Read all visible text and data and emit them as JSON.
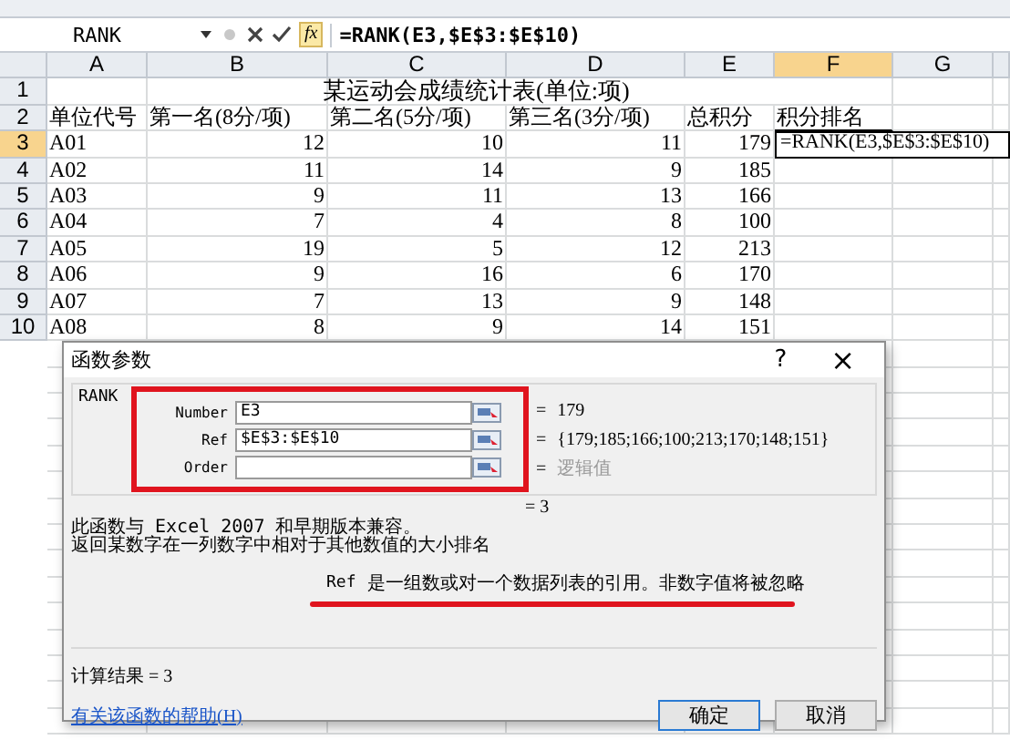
{
  "formula_bar": {
    "name_box": "RANK",
    "function_button": "fx",
    "formula": "=RANK(E3,$E$3:$E$10)"
  },
  "sheet": {
    "columns": [
      {
        "label": "A",
        "selected": false
      },
      {
        "label": "B",
        "selected": false
      },
      {
        "label": "C",
        "selected": false
      },
      {
        "label": "D",
        "selected": false
      },
      {
        "label": "E",
        "selected": false
      },
      {
        "label": "F",
        "selected": true
      },
      {
        "label": "G",
        "selected": false
      }
    ],
    "rows": [
      {
        "number": "1",
        "selected": false,
        "kind": "title",
        "cells": [
          "",
          "",
          "某运动会成绩统计表(单位:项)"
        ]
      },
      {
        "number": "2",
        "selected": false,
        "kind": "header",
        "cells": [
          "单位代号",
          "第一名(8分/项)",
          "第二名(5分/项)",
          "第三名(3分/项)",
          "总积分",
          "积分排名"
        ]
      },
      {
        "number": "3",
        "selected": true,
        "kind": "data",
        "cells": [
          "A01",
          "12",
          "10",
          "11",
          "179",
          "=RANK(E3,$E$3:$E$10)"
        ]
      },
      {
        "number": "4",
        "selected": false,
        "kind": "data",
        "cells": [
          "A02",
          "11",
          "14",
          "9",
          "185"
        ]
      },
      {
        "number": "5",
        "selected": false,
        "kind": "data",
        "cells": [
          "A03",
          "9",
          "11",
          "13",
          "166"
        ]
      },
      {
        "number": "6",
        "selected": false,
        "kind": "data",
        "cells": [
          "A04",
          "7",
          "4",
          "8",
          "100"
        ]
      },
      {
        "number": "7",
        "selected": false,
        "kind": "data",
        "cells": [
          "A05",
          "19",
          "5",
          "12",
          "213"
        ]
      },
      {
        "number": "8",
        "selected": false,
        "kind": "data",
        "cells": [
          "A06",
          "9",
          "16",
          "6",
          "170"
        ]
      },
      {
        "number": "9",
        "selected": false,
        "kind": "data",
        "cells": [
          "A07",
          "7",
          "13",
          "9",
          "148"
        ]
      },
      {
        "number": "10",
        "selected": false,
        "kind": "data",
        "cells": [
          "A08",
          "8",
          "9",
          "14",
          "151"
        ]
      }
    ]
  },
  "dialog": {
    "title": "函数参数",
    "help_glyph": "?",
    "close_glyph": "×",
    "function_name": "RANK",
    "arguments": [
      {
        "label": "Number",
        "value": "E3",
        "equals": "=",
        "result": "179",
        "hint": false
      },
      {
        "label": "Ref",
        "value": "$E$3:$E$10",
        "equals": "=",
        "result": "{179;185;166;100;213;170;148;151}",
        "hint": false
      },
      {
        "label": "Order",
        "equals": "=",
        "result": "逻辑值",
        "hint": true
      }
    ],
    "formula_result": "= 3",
    "description": [
      "此函数与 Excel 2007 和早期版本兼容。",
      "返回某数字在一列数字中相对于其他数值的大小排名"
    ],
    "argument_help": {
      "name": "Ref",
      "text": "是一组数或对一个数据列表的引用。非数字值将被忽略"
    },
    "calc_result": "计算结果 = 3",
    "help_link": "有关该函数的帮助(H)",
    "buttons": [
      {
        "label": "确定",
        "default": true
      },
      {
        "label": "取消",
        "default": false
      }
    ]
  }
}
